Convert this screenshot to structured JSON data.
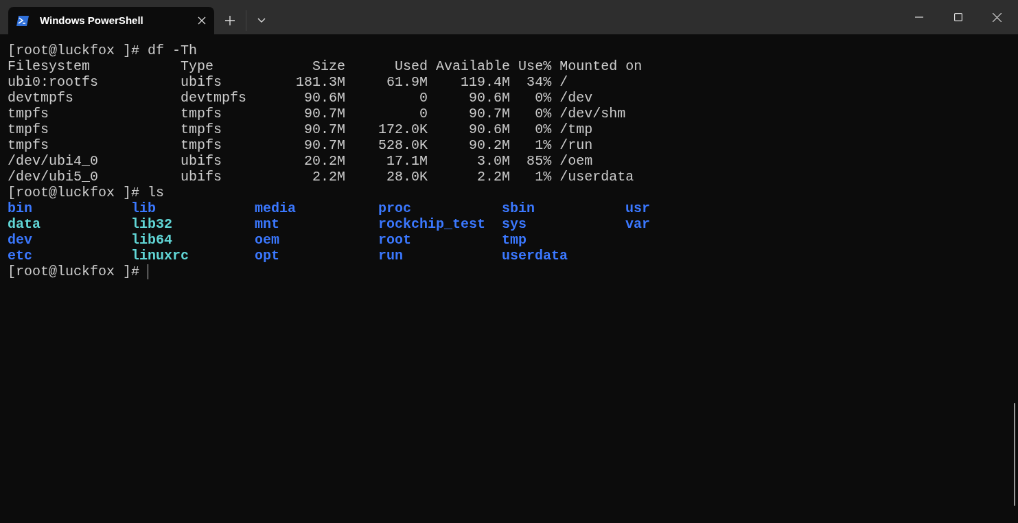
{
  "tabs": [
    {
      "title": "Windows PowerShell",
      "selected": true
    }
  ],
  "terminal": {
    "lines": [
      "[root@luckfox ]# df -Th",
      "Filesystem           Type            Size      Used Available Use% Mounted on",
      "ubi0:rootfs          ubifs         181.3M     61.9M    119.4M  34% /",
      "devtmpfs             devtmpfs       90.6M         0     90.6M   0% /dev",
      "tmpfs                tmpfs          90.7M         0     90.7M   0% /dev/shm",
      "tmpfs                tmpfs          90.7M    172.0K     90.6M   0% /tmp",
      "tmpfs                tmpfs          90.7M    528.0K     90.2M   1% /run",
      "/dev/ubi4_0          ubifs          20.2M     17.1M      3.0M  85% /oem",
      "/dev/ubi5_0          ubifs           2.2M     28.0K      2.2M   1% /userdata",
      "[root@luckfox ]# ls"
    ],
    "listing": [
      [
        {
          "name": "bin",
          "kind": "directory"
        },
        {
          "name": "lib",
          "kind": "directory"
        },
        {
          "name": "media",
          "kind": "directory"
        },
        {
          "name": "proc",
          "kind": "directory"
        },
        {
          "name": "sbin",
          "kind": "directory"
        },
        {
          "name": "usr",
          "kind": "directory"
        }
      ],
      [
        {
          "name": "data",
          "kind": "link"
        },
        {
          "name": "lib32",
          "kind": "link"
        },
        {
          "name": "mnt",
          "kind": "directory"
        },
        {
          "name": "rockchip_test",
          "kind": "directory"
        },
        {
          "name": "sys",
          "kind": "directory"
        },
        {
          "name": "var",
          "kind": "directory"
        }
      ],
      [
        {
          "name": "dev",
          "kind": "directory"
        },
        {
          "name": "lib64",
          "kind": "link"
        },
        {
          "name": "oem",
          "kind": "directory"
        },
        {
          "name": "root",
          "kind": "directory"
        },
        {
          "name": "tmp",
          "kind": "directory"
        }
      ],
      [
        {
          "name": "etc",
          "kind": "directory"
        },
        {
          "name": "linuxrc",
          "kind": "link"
        },
        {
          "name": "opt",
          "kind": "directory"
        },
        {
          "name": "run",
          "kind": "directory"
        },
        {
          "name": "userdata",
          "kind": "directory"
        }
      ]
    ],
    "prompt": "[root@luckfox ]#"
  }
}
